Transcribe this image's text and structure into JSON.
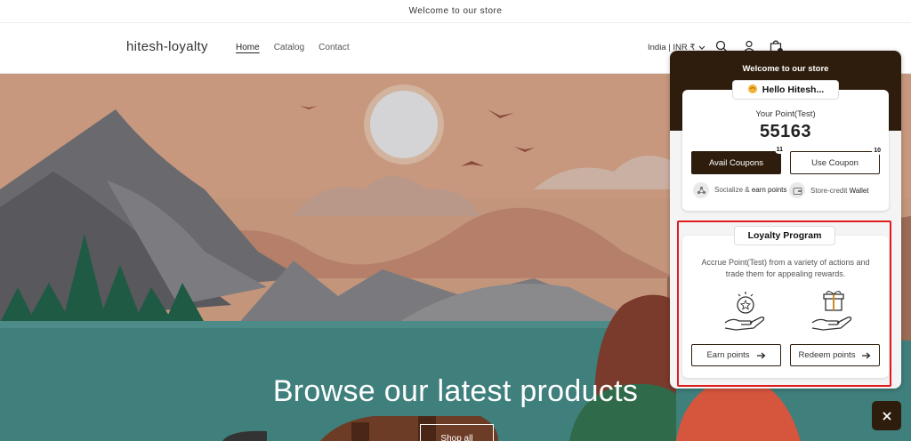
{
  "announcement": "Welcome to our store",
  "header": {
    "logo": "hitesh-loyalty",
    "nav": [
      {
        "label": "Home",
        "active": true
      },
      {
        "label": "Catalog",
        "active": false
      },
      {
        "label": "Contact",
        "active": false
      }
    ],
    "locale": "India | INR ₹",
    "icons": [
      "search-icon",
      "account-icon",
      "cart-icon"
    ]
  },
  "hero": {
    "title": "Browse our latest products",
    "button": "Shop all"
  },
  "widget": {
    "title": "Welcome to our store",
    "greeting": "Hello Hitesh...",
    "points_label": "Your Point(Test)",
    "points_value": "55163",
    "avail_coupons": {
      "label": "Avail Coupons",
      "count": "11"
    },
    "use_coupon": {
      "label": "Use Coupon",
      "count": "10"
    },
    "socialize": {
      "prefix": "Socialize &",
      "emph": "earn points"
    },
    "wallet": {
      "prefix": "Store-credit",
      "emph": "Wallet"
    },
    "loyalty": {
      "title": "Loyalty Program",
      "description": "Accrue Point(Test) from a variety of actions and trade them for appealing rewards.",
      "earn": "Earn points",
      "redeem": "Redeem points"
    }
  },
  "colors": {
    "brand": "#2e1d0c",
    "highlight": "#e01b1b"
  }
}
